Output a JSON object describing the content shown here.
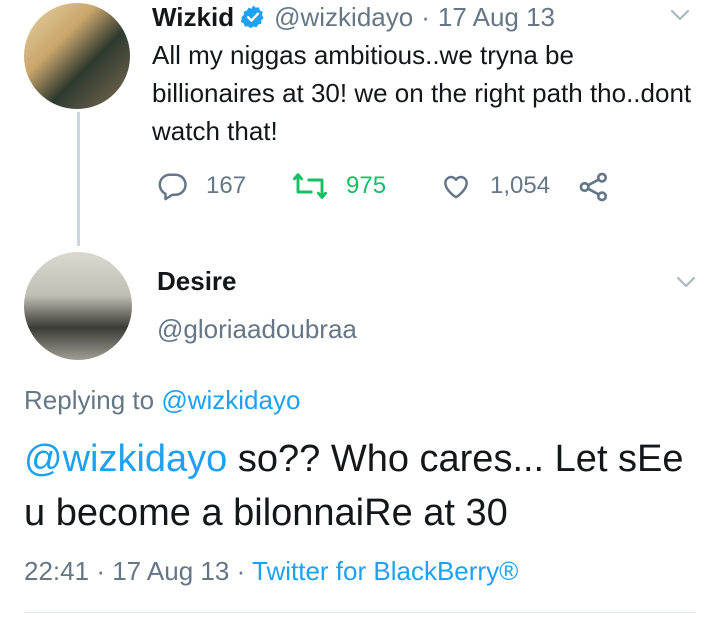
{
  "parent_tweet": {
    "name": "Wizkid",
    "handle": "@wizkidayo",
    "separator": "·",
    "date": "17 Aug 13",
    "text": "All my niggas ambitious..we tryna be billionaires at 30! we on the right path tho..dont watch that!",
    "replies": "167",
    "retweets": "975",
    "likes": "1,054",
    "verified_icon": "verified-badge-icon",
    "colors": {
      "retweet_active": "#17bf63",
      "verified": "#1da1f2"
    }
  },
  "reply_tweet": {
    "name": "Desire",
    "handle": "@gloriaadoubraa",
    "replying_label": "Replying to",
    "replying_to": "@wizkidayo",
    "mention": "@wizkidayo",
    "text": " so?? Who cares... Let sEe u become a bilonnaiRe at 30",
    "time": "22:41",
    "separator": "·",
    "date": "17 Aug 13",
    "source": "Twitter for BlackBerry®",
    "colors": {
      "link": "#1da1f2",
      "muted": "#657786"
    }
  }
}
